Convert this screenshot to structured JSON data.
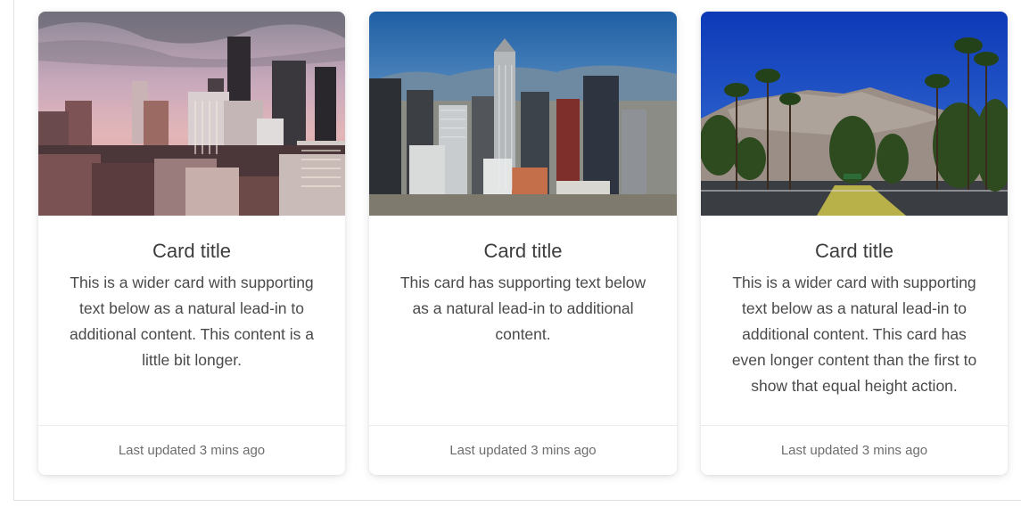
{
  "cards": [
    {
      "image_alt": "city-skyline-dusk",
      "title": "Card title",
      "text": "This is a wider card with supporting text below as a natural lead-in to additional content. This content is a little bit longer.",
      "footer": "Last updated 3 mins ago"
    },
    {
      "image_alt": "downtown-skyscrapers-mountains",
      "title": "Card title",
      "text": "This card has supporting text below as a natural lead-in to additional content.",
      "footer": "Last updated 3 mins ago"
    },
    {
      "image_alt": "palm-tree-avenue-mountains",
      "title": "Card title",
      "text": "This is a wider card with supporting text below as a natural lead-in to additional content. This card has even longer content than the first to show that equal height action.",
      "footer": "Last updated 3 mins ago"
    }
  ]
}
